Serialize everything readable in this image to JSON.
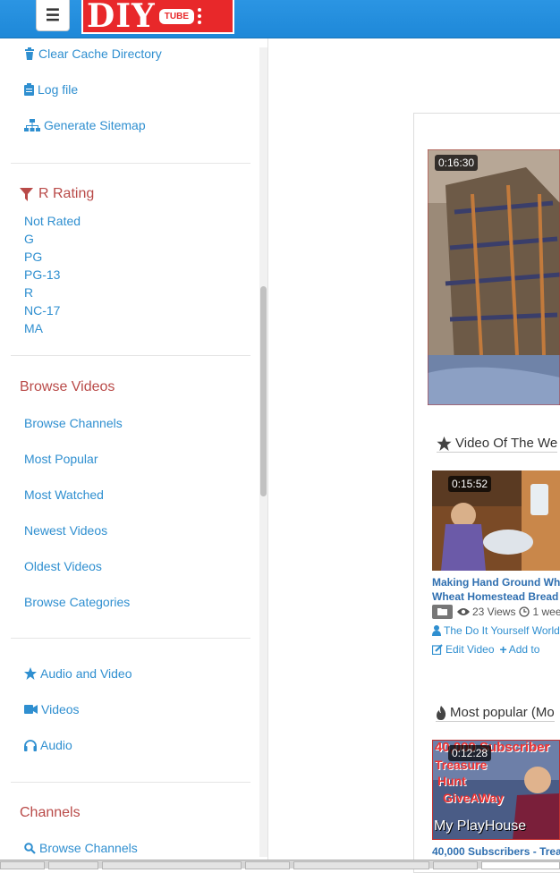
{
  "header": {
    "menu_icon": "hamburger-icon",
    "logo_text": "DIY",
    "logo_badge": "TUBE"
  },
  "sidebar": {
    "admin_links": [
      {
        "label": "Clear Cache Directory",
        "icon": "trash-icon"
      },
      {
        "label": "Log file",
        "icon": "clipboard-icon"
      },
      {
        "label": "Generate Sitemap",
        "icon": "sitemap-icon"
      }
    ],
    "rating_heading": "R Rating",
    "ratings": [
      "Not Rated",
      "G",
      "PG",
      "PG-13",
      "R",
      "NC-17",
      "MA"
    ],
    "browse_heading": "Browse Videos",
    "browse_links": [
      "Browse Channels",
      "Most Popular",
      "Most Watched",
      "Newest Videos",
      "Oldest Videos",
      "Browse Categories"
    ],
    "media_links": [
      {
        "label": "Audio and Video",
        "icon": "star-icon"
      },
      {
        "label": "Videos",
        "icon": "video-camera-icon"
      },
      {
        "label": "Audio",
        "icon": "headphones-icon"
      }
    ],
    "channels_heading": "Channels",
    "channels_links": [
      {
        "label": "Browse Channels",
        "icon": "search-icon"
      }
    ]
  },
  "main": {
    "featured": {
      "duration": "0:16:30"
    },
    "video_of_week": {
      "section_title": "Video Of The We",
      "duration": "0:15:52",
      "title_line1": "Making Hand Ground Wh",
      "title_line2": "Wheat Homestead Bread",
      "views": "23 Views",
      "age": "1 wee",
      "channel": "The Do It Yourself World",
      "edit_label": "Edit Video",
      "add_label": "Add to"
    },
    "most_popular": {
      "section_title": "Most popular (Mo",
      "duration": "0:12:28",
      "thumb_text_1": "40,000 Subscriber",
      "thumb_text_2": "Treasure",
      "thumb_text_3": "Hunt",
      "thumb_text_4": "GiveAWay",
      "thumb_text_5": "My PlayHouse",
      "title": "40,000 Subscribers - Trea"
    }
  },
  "colors": {
    "accent": "#2f8fd0",
    "heading": "#b94a48",
    "topbar": "#1e88d8",
    "logo": "#e8282a"
  }
}
